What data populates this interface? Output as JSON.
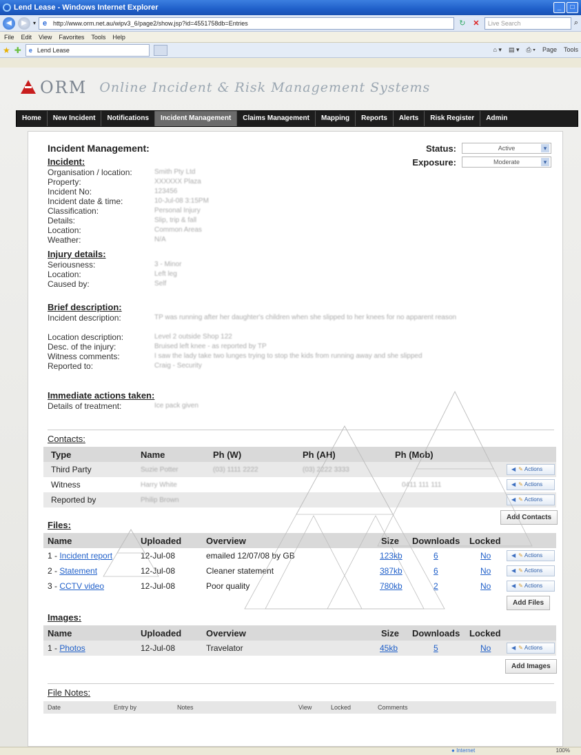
{
  "browser": {
    "title": "Lend Lease - Windows Internet Explorer",
    "url": "http://www.orm.net.au/wipv3_6/page2/show.jsp?id=4551758db=Entries",
    "search_placeholder": "Live Search",
    "menu": [
      "File",
      "Edit",
      "View",
      "Favorites",
      "Tools",
      "Help"
    ],
    "tab_label": "Lend Lease",
    "toolbar_right": [
      "Page",
      "Tools"
    ],
    "status_zone": "Internet",
    "zoom": "100%"
  },
  "brand": {
    "name": "ORM",
    "tagline": "Online Incident & Risk Management Systems"
  },
  "nav": [
    "Home",
    "New Incident",
    "Notifications",
    "Incident Management",
    "Claims Management",
    "Mapping",
    "Reports",
    "Alerts",
    "Risk Register",
    "Admin"
  ],
  "nav_active": "Incident Management",
  "header": {
    "title": "Incident Management:",
    "status_label": "Status:",
    "status_value": "Active",
    "exposure_label": "Exposure:",
    "exposure_value": "Moderate"
  },
  "incident": {
    "heading": "Incident:",
    "fields": [
      {
        "label": "Organisation / location:",
        "value": "Smith Pty Ltd"
      },
      {
        "label": "Property:",
        "value": "XXXXXX Plaza"
      },
      {
        "label": "Incident No:",
        "value": "123456"
      },
      {
        "label": "Incident date & time:",
        "value": "10-Jul-08  3:15PM"
      },
      {
        "label": "Classification:",
        "value": "Personal Injury"
      },
      {
        "label": "Details:",
        "value": "Slip, trip & fall"
      },
      {
        "label": "Location:",
        "value": "Common Areas"
      },
      {
        "label": "Weather:",
        "value": "N/A"
      }
    ]
  },
  "injury": {
    "heading": "Injury details:",
    "fields": [
      {
        "label": "Seriousness:",
        "value": "3 - Minor"
      },
      {
        "label": "Location:",
        "value": "Left leg"
      },
      {
        "label": "Caused by:",
        "value": "Self"
      }
    ]
  },
  "brief": {
    "heading": "Brief description:",
    "fields": [
      {
        "label": "Incident description:",
        "value": "TP was running after her daughter's children when she slipped to her knees for no apparent reason"
      },
      {
        "label": "Location description:",
        "value": "Level 2 outside Shop 122"
      },
      {
        "label": "Desc. of the injury:",
        "value": "Bruised left knee - as reported by TP"
      },
      {
        "label": "Witness comments:",
        "value": "I saw the lady take two lunges trying to stop the kids from running away and she slipped"
      },
      {
        "label": "Reported to:",
        "value": "Craig - Security"
      }
    ]
  },
  "actions_taken": {
    "heading": "Immediate actions taken:",
    "fields": [
      {
        "label": "Details of treatment:",
        "value": "Ice pack given"
      }
    ]
  },
  "contacts": {
    "heading": "Contacts:",
    "columns": [
      "Type",
      "Name",
      "Ph (W)",
      "Ph (AH)",
      "Ph (Mob)"
    ],
    "rows": [
      {
        "type": "Third Party",
        "name": "Suzie Potter",
        "ph_w": "(03) 1111 2222",
        "ph_ah": "(03) 2222 3333",
        "ph_mob": ""
      },
      {
        "type": "Witness",
        "name": "Harry White",
        "ph_w": "",
        "ph_ah": "",
        "ph_mob": "0411 111 111"
      },
      {
        "type": "Reported by",
        "name": "Philip Brown",
        "ph_w": "",
        "ph_ah": "",
        "ph_mob": ""
      }
    ],
    "add_label": "Add Contacts"
  },
  "actions_label": "Actions",
  "files": {
    "heading": "Files:",
    "columns": [
      "Name",
      "Uploaded",
      "Overview",
      "Size",
      "Downloads",
      "Locked"
    ],
    "rows": [
      {
        "num": "1 - ",
        "name": "Incident report",
        "uploaded": "12-Jul-08",
        "overview": "emailed 12/07/08 by GB",
        "size": "123kb",
        "downloads": "6",
        "locked": "No"
      },
      {
        "num": "2 - ",
        "name": "Statement",
        "uploaded": "12-Jul-08",
        "overview": "Cleaner statement",
        "size": "387kb",
        "downloads": "6",
        "locked": "No"
      },
      {
        "num": "3 - ",
        "name": "CCTV video",
        "uploaded": "12-Jul-08",
        "overview": "Poor quality",
        "size": "780kb",
        "downloads": "2",
        "locked": "No"
      }
    ],
    "add_label": "Add Files"
  },
  "images": {
    "heading": "Images:",
    "columns": [
      "Name",
      "Uploaded",
      "Overview",
      "Size",
      "Downloads",
      "Locked"
    ],
    "rows": [
      {
        "num": "1 - ",
        "name": "Photos",
        "uploaded": "12-Jul-08",
        "overview": "Travelator",
        "size": "45kb",
        "downloads": "5",
        "locked": "No"
      }
    ],
    "add_label": "Add Images"
  },
  "file_notes": {
    "heading": "File Notes:",
    "columns": [
      "Date",
      "Entry by",
      "Notes",
      "View",
      "Locked",
      "Comments"
    ]
  }
}
